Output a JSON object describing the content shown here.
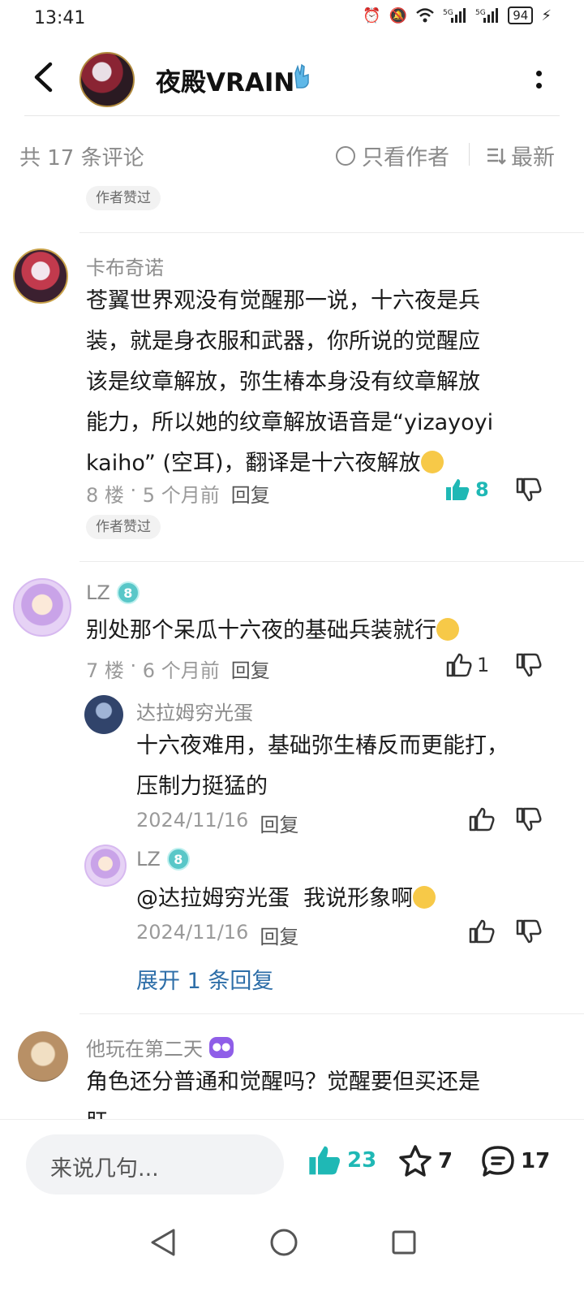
{
  "status_bar": {
    "time": "13:41",
    "battery": "94"
  },
  "header": {
    "title": "夜殿VRAIN"
  },
  "sort_bar": {
    "count_text": "共 17 条评论",
    "author_only": "只看作者",
    "sort_latest": "最新"
  },
  "top_pill": "作者赞过",
  "comments": [
    {
      "username": "卡布奇诺",
      "text_lines": [
        "苍翼世界观没有觉醒那一说，十六夜是兵",
        "装，就是身衣服和武器，你所说的觉醒应",
        "该是纹章解放，弥生椿本身没有纹章解放",
        "能力，所以她的纹章解放语音是“yizayoyi",
        "kaiho” (空耳)，翻译是十六夜解放"
      ],
      "floor": "8 楼",
      "time": "5 个月前",
      "reply": "回复",
      "likes": "8",
      "pill": "作者赞过"
    },
    {
      "username": "LZ",
      "level": "8",
      "text": "别处那个呆瓜十六夜的基础兵装就行",
      "floor": "7 楼",
      "time": "6 个月前",
      "reply": "回复",
      "likes": "1",
      "replies": [
        {
          "username": "达拉姆穷光蛋",
          "text_lines": [
            "十六夜难用，基础弥生椿反而更能打，",
            "压制力挺猛的"
          ],
          "date": "2024/11/16",
          "reply": "回复"
        },
        {
          "username": "LZ",
          "level": "8",
          "mention": "@达拉姆穷光蛋",
          "text": "我说形象啊",
          "date": "2024/11/16",
          "reply": "回复"
        }
      ],
      "expand": "展开 1 条回复"
    },
    {
      "username": "他玩在第二天",
      "badge": "游戏",
      "text_lines": [
        "角色还分普通和觉醒吗？觉醒要但买还是",
        "肝"
      ]
    }
  ],
  "bottom_bar": {
    "placeholder": "来说几句...",
    "likes": "23",
    "favorites": "7",
    "comments": "17"
  },
  "colors": {
    "accent": "#1fb8b5",
    "link": "#2d6ea8",
    "muted": "#8c8c8c"
  }
}
